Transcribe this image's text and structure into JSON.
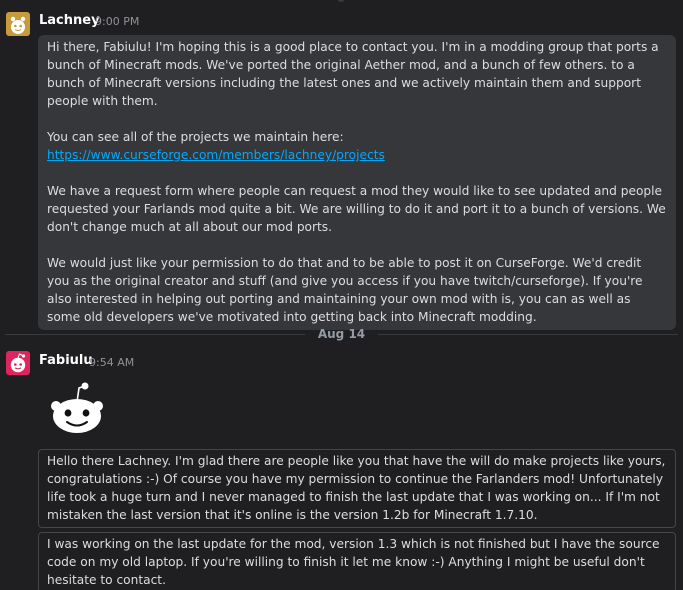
{
  "messages": [
    {
      "username": "Lachney",
      "time": "9:00 PM",
      "paragraphs": [
        "Hi there, Fabiulu! I'm hoping this is a good place to contact you. I'm in a modding group that ports a bunch of Minecraft mods. We've ported the original Aether mod, and a bunch of few others. to a bunch of Minecraft versions including the latest ones and we actively maintain them and support people with them.",
        "You can see all of the projects we maintain here:",
        "We have a request form where people can request a mod they would like to see updated and people requested your Farlands mod quite a bit. We are willing to do it and port it to a bunch of versions. We don't change much at all about our mod ports.",
        "We would just like your permission to do that and to be able to post it on CurseForge. We'd credit you as the original creator and stuff (and give you access if you have twitch/curseforge). If you're also interested in helping out porting and maintaining your own mod with is, you can as well as some old developers we've motivated into getting back into Minecraft modding."
      ],
      "link": "https://www.curseforge.com/members/lachney/projects"
    },
    {
      "username": "Fabiulu",
      "time": "9:54 AM",
      "quote1": "Hello there Lachney. I'm glad there are people like you that have the will do make projects like yours, congratulations :-) Of course you have my permission to continue the Farlanders mod! Unfortunately life took a huge turn and I never managed to finish the last update that I was working on... If I'm not mistaken the last version that it's online is the version 1.2b for Minecraft 1.7.10.",
      "quote2": "I was working on the last update for the mod, version 1.3 which is not finished but I have the source code on my old laptop. If you're willing to finish it let me know :-) Anything I might be useful don't hesitate to contact."
    }
  ],
  "date_divider": "Aug 14",
  "icons": {
    "lachney_avatar": "snoo-avatar-icon",
    "fabiulu_avatar": "snoo-avatar-icon",
    "emoji": "snoo-face-icon"
  },
  "colors": {
    "background": "#1f1f21",
    "bubble": "#36373b",
    "link": "#00a8fc",
    "lachney_avatar_bg": "#c99a3c",
    "fabiulu_avatar_bg": "#e0245e"
  }
}
